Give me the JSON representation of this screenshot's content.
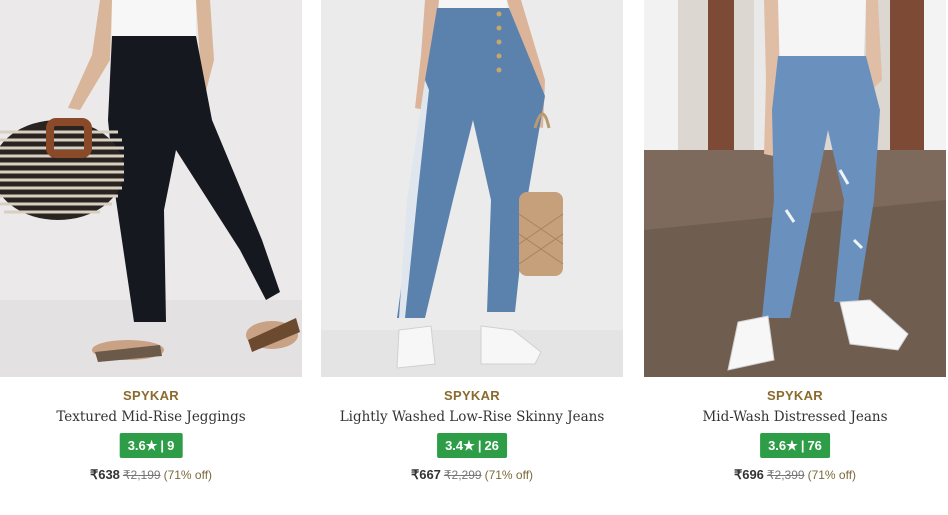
{
  "products": [
    {
      "brand": "SPYKAR",
      "name": "Textured Mid-Rise Jeggings",
      "rating": "3.6",
      "star": "★",
      "reviews": "9",
      "price": "₹638",
      "mrp": "₹2,199",
      "discount": "(71% off)",
      "image": "black jeggings model with striped bag"
    },
    {
      "brand": "SPYKAR",
      "name": "Lightly Washed Low-Rise Skinny Jeans",
      "rating": "3.4",
      "star": "★",
      "reviews": "26",
      "price": "₹667",
      "mrp": "₹2,299",
      "discount": "(71% off)",
      "image": "blue skinny jeans model with tan bag"
    },
    {
      "brand": "SPYKAR",
      "name": "Mid-Wash Distressed Jeans",
      "rating": "3.6",
      "star": "★",
      "reviews": "76",
      "price": "₹696",
      "mrp": "₹2,399",
      "discount": "(71% off)",
      "image": "distressed blue jeans model in hallway"
    }
  ],
  "colors": {
    "brand": "#8a6a2e",
    "rating_bg": "#2e9d48",
    "discount": "#7a6a3c"
  }
}
